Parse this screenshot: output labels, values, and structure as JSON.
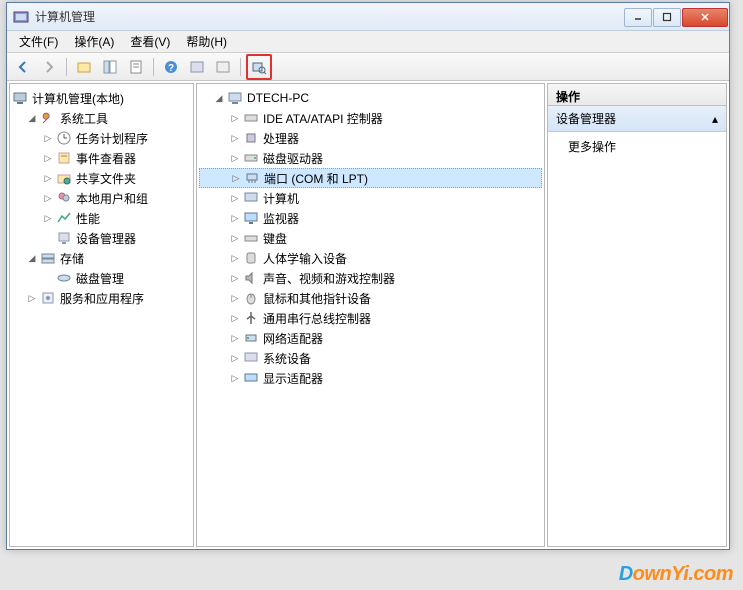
{
  "window": {
    "title": "计算机管理"
  },
  "menu": {
    "file": "文件(F)",
    "action": "操作(A)",
    "view": "查看(V)",
    "help": "帮助(H)"
  },
  "left_tree": {
    "root": "计算机管理(本地)",
    "system_tools": "系统工具",
    "task_scheduler": "任务计划程序",
    "event_viewer": "事件查看器",
    "shared_folders": "共享文件夹",
    "local_users": "本地用户和组",
    "performance": "性能",
    "device_manager": "设备管理器",
    "storage": "存储",
    "disk_mgmt": "磁盘管理",
    "services_apps": "服务和应用程序"
  },
  "mid_tree": {
    "root": "DTECH-PC",
    "ide": "IDE ATA/ATAPI 控制器",
    "cpu": "处理器",
    "disk_drives": "磁盘驱动器",
    "ports": "端口 (COM 和 LPT)",
    "computer": "计算机",
    "monitors": "监视器",
    "keyboards": "键盘",
    "hid": "人体学输入设备",
    "sound": "声音、视频和游戏控制器",
    "mouse": "鼠标和其他指针设备",
    "usb": "通用串行总线控制器",
    "network": "网络适配器",
    "system_devices": "系统设备",
    "display": "显示适配器"
  },
  "actions": {
    "header": "操作",
    "section": "设备管理器",
    "more": "更多操作"
  },
  "watermark": {
    "d": "D",
    "rest": "ownYi.com"
  }
}
